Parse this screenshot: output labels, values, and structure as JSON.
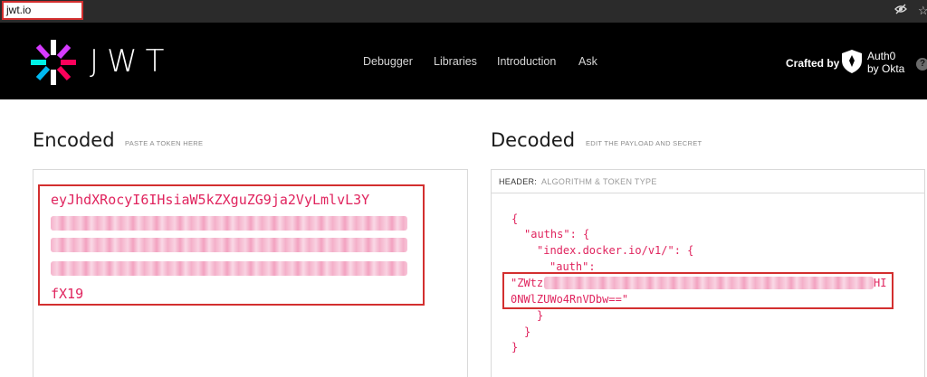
{
  "browser": {
    "url": "jwt.io",
    "icons": [
      "eye-off-icon",
      "star-icon"
    ]
  },
  "header": {
    "logo_text": "JWT",
    "nav": [
      "Debugger",
      "Libraries",
      "Introduction",
      "Ask"
    ],
    "crafted_by": "Crafted by",
    "brand_line1": "Auth0",
    "brand_line2": "by Okta",
    "help": "?"
  },
  "encoded": {
    "title": "Encoded",
    "hint": "PASTE A TOKEN HERE",
    "token_first_line": "eyJhdXRocyI6IHsiaW5kZXguZG9ja2VyLmlvL3Y",
    "token_last_line": "fX19"
  },
  "decoded": {
    "title": "Decoded",
    "hint": "EDIT THE PAYLOAD AND SECRET",
    "header_label": "HEADER:",
    "header_sub": "ALGORITHM & TOKEN TYPE",
    "code": {
      "l1": "{",
      "l2": "\"auths\": {",
      "l3": "\"index.docker.io/v1/\": {",
      "l4": "\"auth\":",
      "l5_prefix": "\"ZWtz",
      "l5_suffix": "HI",
      "l6": "0NWlZUWo4RnVDbw==\"",
      "l7": "}",
      "l8": "}",
      "l9": "}"
    }
  },
  "colors": {
    "header_bg": "#000000",
    "token_color": "#e0245e",
    "highlight_border": "#d32f2f"
  }
}
